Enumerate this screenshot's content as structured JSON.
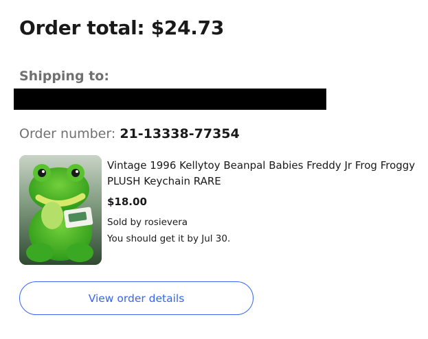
{
  "order": {
    "total_label": "Order total:",
    "total_value": "$24.73",
    "shipping_label": "Shipping to:",
    "number_label": "Order number:",
    "number_value": "21-13338-77354"
  },
  "item": {
    "title": "Vintage 1996 Kellytoy Beanpal Babies Freddy Jr Frog Froggy PLUSH Keychain RARE",
    "price": "$18.00",
    "seller": "Sold by rosievera",
    "delivery": "You should get it by Jul 30.",
    "image_icon": "frog-plush-photo"
  },
  "actions": {
    "view_details_label": "View order details"
  },
  "colors": {
    "accent": "#3665f3",
    "text": "#191919",
    "muted": "#707070",
    "redaction": "#000000"
  }
}
